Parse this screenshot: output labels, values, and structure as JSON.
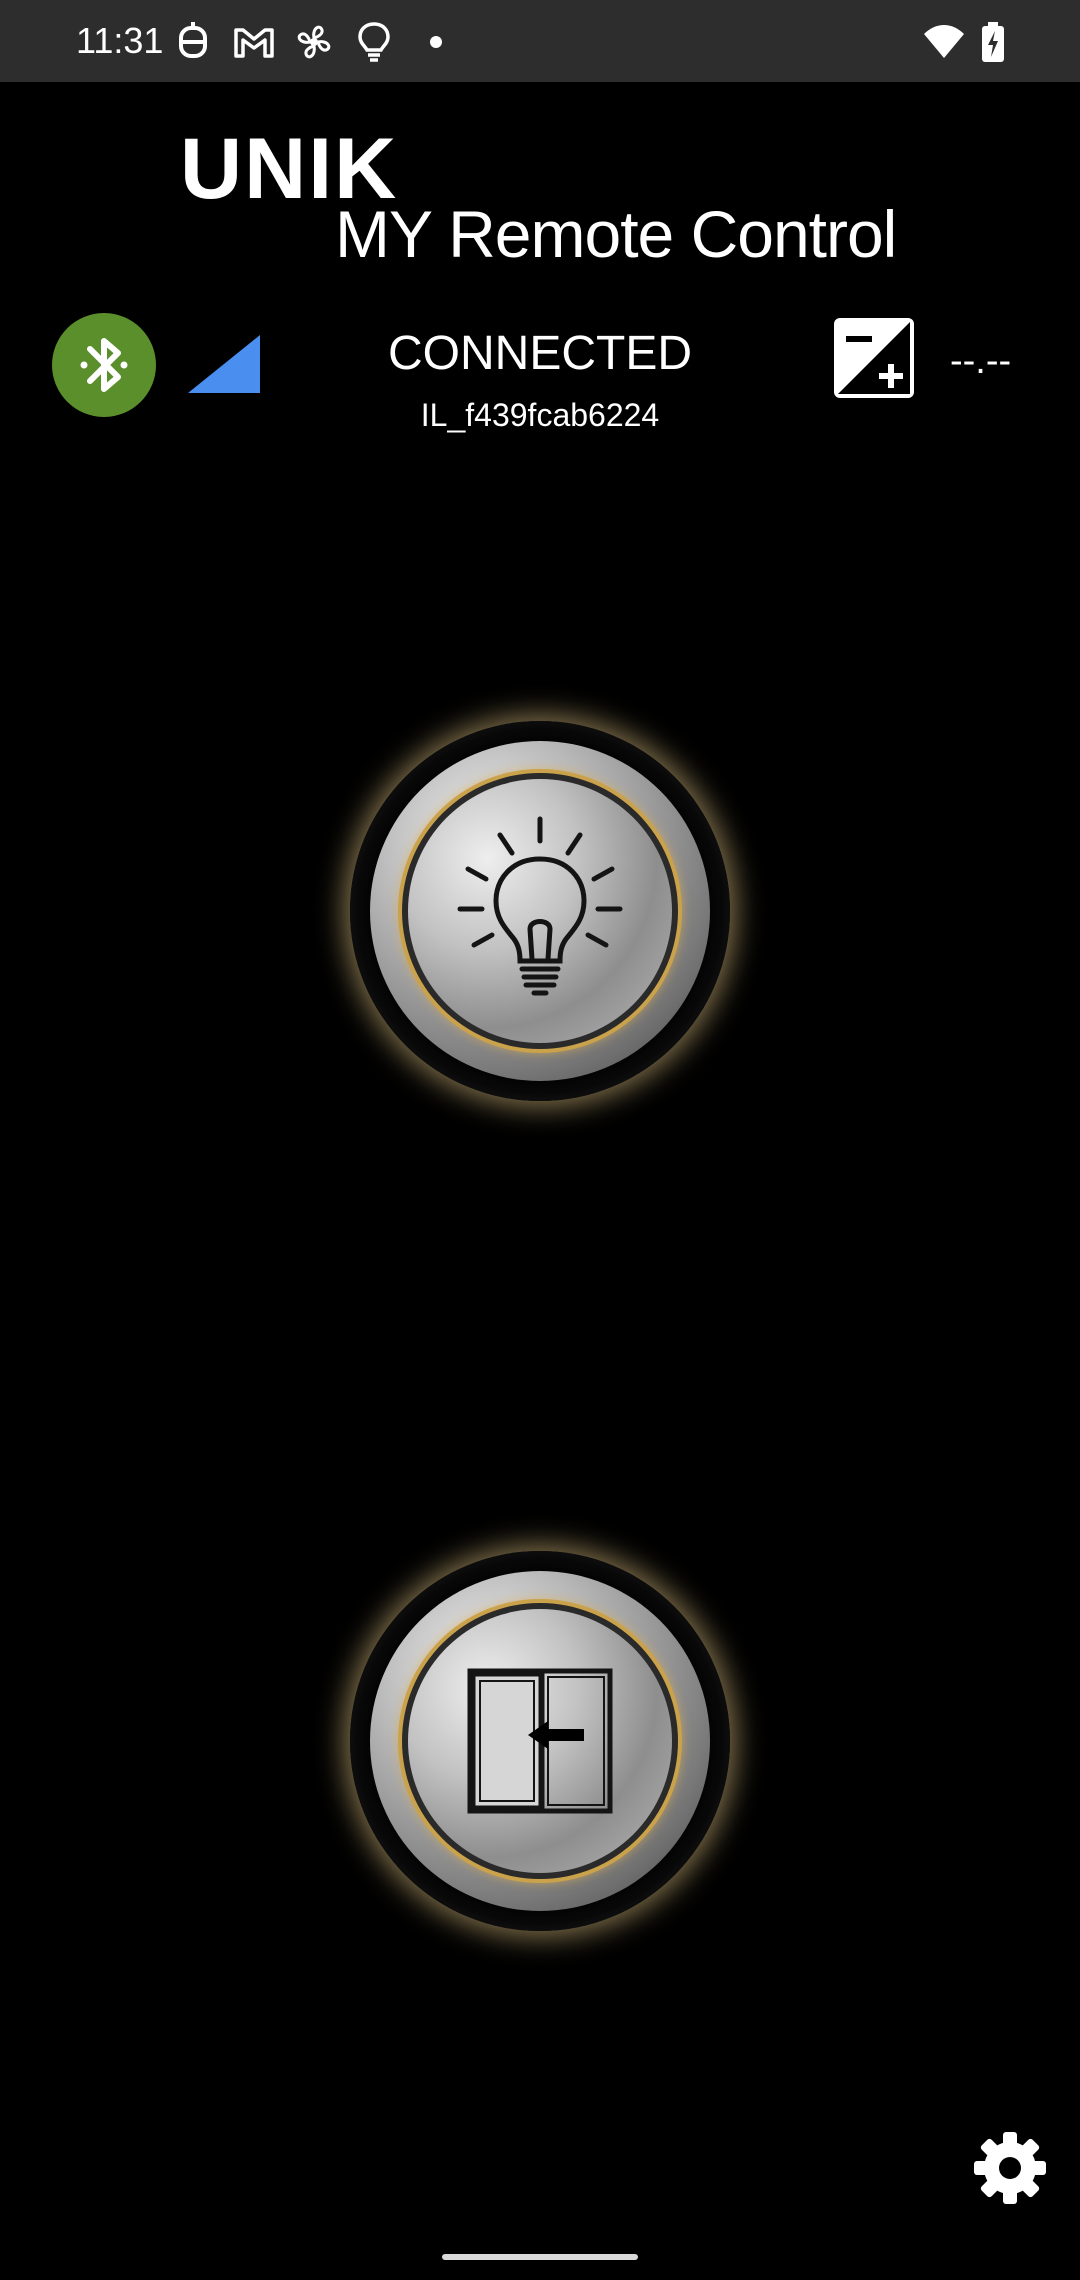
{
  "status_bar": {
    "time": "11:31",
    "icons": [
      "vpn-key-icon",
      "gmail-icon",
      "fan-icon",
      "lightbulb-icon",
      "dot-icon",
      "wifi-icon",
      "battery-charging-icon"
    ]
  },
  "logo": {
    "brand": "UNIK",
    "subtitle": "MY Remote Control"
  },
  "connection": {
    "status": "CONNECTED",
    "device_id": "IL_f439fcab6224",
    "reading": "--.--",
    "bluetooth_color": "#5b8f2c",
    "signal_color": "#4a8ef0"
  },
  "buttons": {
    "light": "lightbulb-icon",
    "door": "sliding-door-icon",
    "settings": "gear-icon"
  },
  "colors": {
    "background": "#000000",
    "status_bar": "#2d2d2d",
    "accent_gold": "#caa24b"
  }
}
